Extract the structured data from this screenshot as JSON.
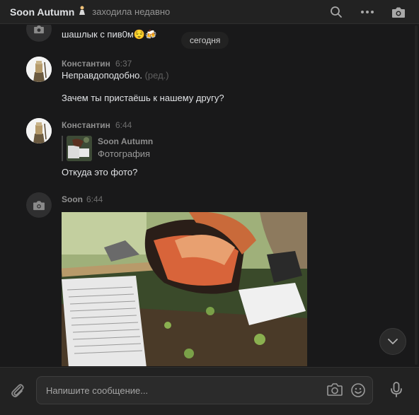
{
  "header": {
    "name": "Soon Autumn",
    "status": "заходила недавно",
    "icons": [
      "search-icon",
      "more-icon",
      "camera-icon"
    ]
  },
  "chat": {
    "date_divider": "сегодня",
    "top_message_text": "шашлык с пив0м😌🍻",
    "messages": [
      {
        "author": "Константин",
        "time": "6:37",
        "lines": [
          "Неправдоподобно.",
          "Зачем ты пристаёшь к нашему другу?"
        ],
        "edited": "(ред.)"
      },
      {
        "author": "Константин",
        "time": "6:44",
        "forward": {
          "name": "Soon Autumn",
          "subtitle": "Фотография"
        },
        "text": "Откуда это фото?"
      },
      {
        "author": "Soon",
        "time": "6:44"
      }
    ]
  },
  "composer": {
    "placeholder": "Напишите сообщение..."
  },
  "colors": {
    "background": "#19191a",
    "panel": "#222222",
    "text": "#e1e3e6",
    "muted": "#939393"
  }
}
